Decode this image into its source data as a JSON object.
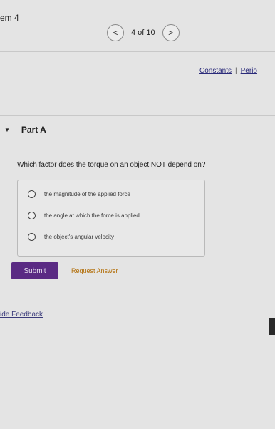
{
  "header": {
    "item_title": "em 4",
    "nav": {
      "prev_symbol": "<",
      "next_symbol": ">",
      "position": "4 of 10"
    },
    "links": {
      "constants": "Constants",
      "separator": "|",
      "periodic": "Perio"
    }
  },
  "part": {
    "caret": "▼",
    "title": "Part A",
    "question": "Which factor does the torque on an object NOT depend on?",
    "choices": [
      "the magnitude of the applied force",
      "the angle at which the force is applied",
      "the object's angular velocity"
    ],
    "submit_label": "Submit",
    "request_label": "Request Answer"
  },
  "footer": {
    "feedback": "ide Feedback"
  },
  "colors": {
    "submit_bg": "#5a2a83",
    "link": "#2b2b7a",
    "request": "#b06a00"
  }
}
